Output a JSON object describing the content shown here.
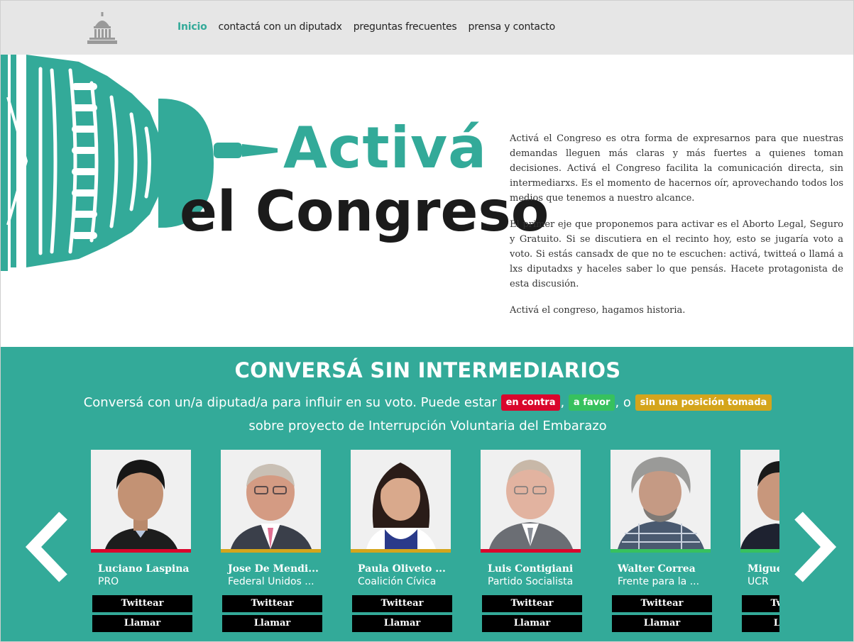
{
  "colors": {
    "brand_teal": "#33aa99",
    "nav_bg": "#e6e6e6",
    "against": "#d9062c",
    "favor": "#37c15e",
    "undecided": "#d4a51c"
  },
  "nav": {
    "logo_icon": "capitol-dome-icon",
    "links": [
      "Inicio",
      "contactá con un diputadx",
      "preguntas frecuentes",
      "prensa y contacto"
    ],
    "active_index": 0
  },
  "hero": {
    "brand_line1": "Activá",
    "brand_line2": "el Congreso",
    "paragraphs": [
      "Activá el Congreso es otra forma de expresarnos para que nuestras demandas lleguen más claras y más fuertes a quienes toman decisiones. Activá el Congreso facilita la comunicación directa, sin intermediarxs. Es el momento de hacernos oír, aprovechando todos los medios que tenemos a nuestro alcance.",
      "El primer eje que proponemos para activar es el Aborto Legal, Seguro y Gratuito. Si se discutiera en el recinto hoy, esto se jugaría voto a voto. Si estás cansadx de que no te escuchen: activá, twitteá o llamá a lxs diputadxs y haceles saber lo que pensás. Hacete protagonista de esta discusión.",
      "Activá el congreso, hagamos historia."
    ]
  },
  "section": {
    "title": "CONVERSÁ SIN INTERMEDIARIOS",
    "sub_before": "Conversá con un/a diputad/a para influir en su voto. Puede estar ",
    "pill_against": "en contra",
    "sep1": ", ",
    "pill_favor": "a favor",
    "sep2": ", o ",
    "pill_undecided": "sin una posición tomada",
    "sub_after": " sobre proyecto de Interrupción Voluntaria del Embarazo"
  },
  "carousel": {
    "prev_icon": "chevron-left-icon",
    "next_icon": "chevron-right-icon",
    "twitter_label": "Twittear",
    "call_label": "Llamar",
    "deputies": [
      {
        "name": "Luciano Laspina",
        "party": "PRO",
        "stance_color": "#d9062c"
      },
      {
        "name": "Jose De Mendi...",
        "party": "Federal Unidos ...",
        "stance_color": "#d4a51c"
      },
      {
        "name": "Paula Oliveto ...",
        "party": "Coalición Cívica",
        "stance_color": "#d4a51c"
      },
      {
        "name": "Luis Contigiani",
        "party": "Partido Socialista",
        "stance_color": "#d9062c"
      },
      {
        "name": "Walter Correa",
        "party": "Frente para la ...",
        "stance_color": "#37c15e"
      },
      {
        "name": "Miguel",
        "party": "UCR",
        "stance_color": "#37c15e"
      }
    ]
  }
}
